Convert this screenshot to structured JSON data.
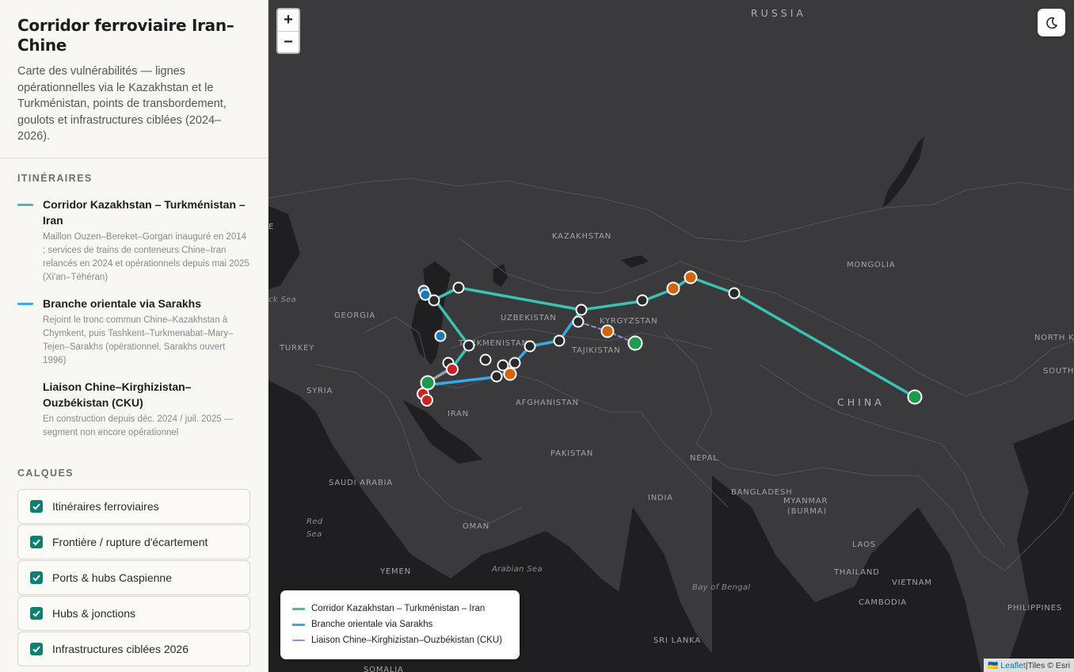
{
  "header": {
    "title": "Corridor ferroviaire Iran–Chine",
    "subtitle": "Carte des vulnérabilités — lignes opérationnelles via le Kazakhstan et le Turkménistan, points de transbordement, goulots et infrastructures ciblées (2024–2026)."
  },
  "routes": {
    "section_title": "ITINÉRAIRES",
    "items": [
      {
        "name": "Corridor Kazakhstan – Turkménistan – Iran",
        "desc": "Maillon Ouzen–Bereket–Gorgan inauguré en 2014 ; services de trains de conteneurs Chine–Iran relancés en 2024 et opérationnels depuis mai 2025 (Xi'an–Téhéran)",
        "color": "#3cc2b4"
      },
      {
        "name": "Branche orientale via Sarakhs",
        "desc": "Rejoint le tronc commun Chine–Kazakhstan à Chymkent, puis Tashkent–Turkmenabat–Mary–Tejen–Sarakhs (opérationnel, Sarakhs ouvert 1996)",
        "color": "#39a9e6"
      },
      {
        "name": "Liaison Chine–Kirghizistan–Ouzbékistan (CKU)",
        "desc": "En construction depuis déc. 2024 / juil. 2025 — segment non encore opérationnel",
        "color": "#9c88d6"
      }
    ]
  },
  "layers": {
    "section_title": "CALQUES",
    "items": [
      {
        "label": "Itinéraires ferroviaires",
        "checked": true
      },
      {
        "label": "Frontière / rupture d'écartement",
        "checked": true
      },
      {
        "label": "Ports & hubs Caspienne",
        "checked": true
      },
      {
        "label": "Hubs & jonctions",
        "checked": true
      },
      {
        "label": "Infrastructures ciblées 2026",
        "checked": true
      }
    ]
  },
  "map": {
    "zoom_in": "+",
    "zoom_out": "−",
    "labels": {
      "russia": "RUSSIA",
      "kazakhstan": "KAZAKHSTAN",
      "mongolia": "MONGOLIA",
      "china": "CHINA",
      "uzbekistan": "UZBEKISTAN",
      "kyrgyzstan": "KYRGYZSTAN",
      "turkmenistan": "TURKMENISTAN",
      "tajikistan": "TAJIKISTAN",
      "georgia": "GEORGIA",
      "turkey": "TURKEY",
      "syria": "SYRIA",
      "iran": "IRAN",
      "afghanistan": "AFGHANISTAN",
      "pakistan": "PAKISTAN",
      "nepal": "NEPAL",
      "india": "INDIA",
      "bangladesh": "BANGLADESH",
      "myanmar": "MYANMAR",
      "burma": "(BURMA)",
      "saudi": "SAUDI ARABIA",
      "oman": "OMAN",
      "yemen": "YEMEN",
      "laos": "LAOS",
      "thailand": "THAILAND",
      "vietnam": "VIETNAM",
      "cambodia": "CAMBODIA",
      "philippines": "PHILIPPINES",
      "srilanka": "SRI LANKA",
      "somalia": "SOMALIA",
      "northk": "NORTH K",
      "south": "SOUTH",
      "e_fragment": "E",
      "blacksea": "ck Sea",
      "redsea1": "Red",
      "redsea2": "Sea",
      "arabian": "Arabian Sea",
      "bengal": "Bay of Bengal"
    },
    "legend": [
      {
        "label": "Corridor Kazakhstan – Turkménistan – Iran",
        "color": "#3cc2b4",
        "style": "solid"
      },
      {
        "label": "Branche orientale via Sarakhs",
        "color": "#39a9e6",
        "style": "solid"
      },
      {
        "label": "Liaison Chine–Kirghizistan–Ouzbékistan (CKU)",
        "color": "#9c88d6",
        "style": "dashed"
      }
    ],
    "attribution": {
      "flag": "🇺🇦",
      "leaflet": "Leaflet",
      "sep": " | ",
      "tiles": "Tiles © Esri"
    },
    "marker_colors": {
      "hub": "#2a2a2d",
      "port": "#1f78b4",
      "border": "#d26410",
      "terminus": "#1e9a4c",
      "target": "#cc2222"
    }
  }
}
